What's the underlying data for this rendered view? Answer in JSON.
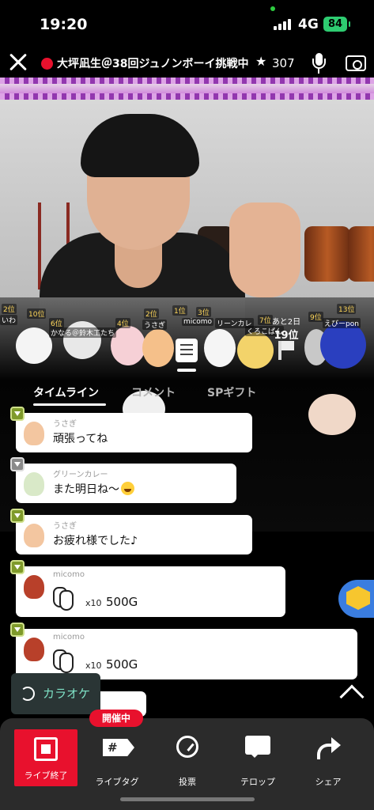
{
  "status_bar": {
    "time": "19:20",
    "network": "4G",
    "battery": "84"
  },
  "header": {
    "title": "大坪凪生＠38回ジュノンボーイ挑戦中",
    "star_count": "307"
  },
  "overlay": {
    "rank_labels": [
      "2位",
      "10位",
      "6位",
      "2位",
      "4位",
      "1位",
      "3位",
      "7位",
      "9位",
      "13位"
    ],
    "rank_names": [
      "いわ",
      "かなる＠鈴木工たち",
      "うさぎ",
      "micomo",
      "リーンカレ",
      "くろこぱん",
      "えびーpon"
    ],
    "remaining": "あと2日",
    "rank": "19位"
  },
  "tabs": [
    {
      "label": "タイムライン",
      "active": true
    },
    {
      "label": "コメント",
      "active": false
    },
    {
      "label": "SPギフト",
      "active": false
    }
  ],
  "comments": [
    {
      "user": "うさぎ",
      "text": "頑張ってね"
    },
    {
      "user": "グリーンカレー",
      "text": "また明日ね〜"
    },
    {
      "user": "うさぎ",
      "text": "お疲れ様でした♪"
    }
  ],
  "gifts": [
    {
      "user": "micomo",
      "qty": "x10",
      "value": "500G"
    },
    {
      "user": "micomo",
      "qty": "x10",
      "value": "500G"
    }
  ],
  "karaoke": {
    "label": "カラオケ"
  },
  "bottom_nav": {
    "live_badge": "開催中",
    "items": [
      {
        "label": "ライブ終了"
      },
      {
        "label": "ライブタグ",
        "icon_text": "#"
      },
      {
        "label": "投票"
      },
      {
        "label": "テロップ"
      },
      {
        "label": "シェア"
      }
    ]
  },
  "colors": {
    "accent_red": "#e8112d",
    "karaoke_text": "#7fe3c7",
    "gift_button": "#3a7de0"
  }
}
